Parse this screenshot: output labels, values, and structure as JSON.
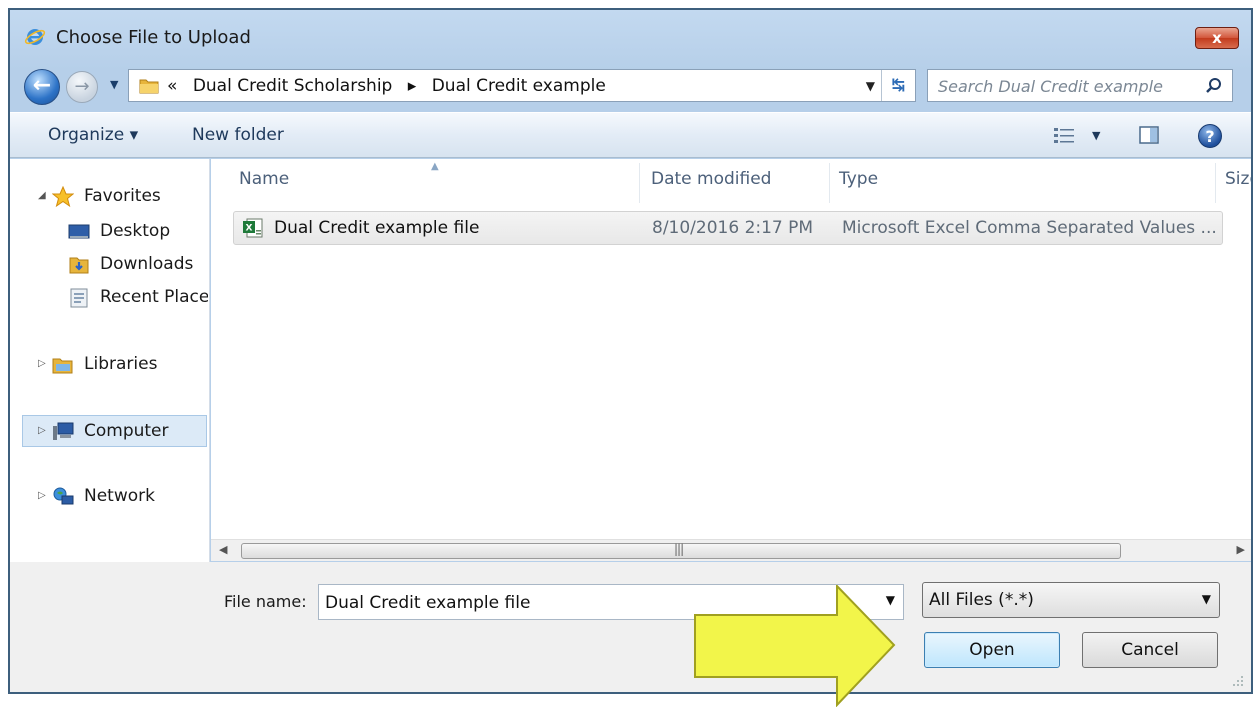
{
  "window": {
    "title": "Choose File to Upload",
    "close_label": "x"
  },
  "nav": {
    "breadcrumb_prefix": "«",
    "breadcrumbs": [
      "Dual Credit Scholarship",
      "Dual Credit example"
    ],
    "separator": "▸",
    "search_placeholder": "Search Dual Credit example"
  },
  "toolbar": {
    "organize_label": "Organize ▾",
    "new_folder_label": "New folder",
    "help_label": "?"
  },
  "sidebar": {
    "items": [
      {
        "label": "Favorites",
        "icon": "star-icon"
      },
      {
        "label": "Desktop",
        "icon": "desktop-icon"
      },
      {
        "label": "Downloads",
        "icon": "downloads-folder-icon"
      },
      {
        "label": "Recent Places",
        "icon": "recent-places-icon"
      },
      {
        "label": "Libraries",
        "icon": "libraries-icon"
      },
      {
        "label": "Computer",
        "icon": "computer-icon"
      },
      {
        "label": "Network",
        "icon": "network-icon"
      }
    ],
    "selected": "Computer"
  },
  "table": {
    "columns": [
      "Name",
      "Date modified",
      "Type",
      "Size"
    ],
    "rows": [
      {
        "name": "Dual Credit example file",
        "date": "8/10/2016 2:17 PM",
        "type": "Microsoft Excel Comma Separated Values ...",
        "icon": "excel-csv-icon"
      }
    ]
  },
  "footer": {
    "file_name_label": "File name:",
    "file_name_value": "Dual Credit example file",
    "file_type_value": "All Files (*.*)",
    "open_label": "Open",
    "cancel_label": "Cancel"
  },
  "colors": {
    "annotation_arrow": "#f2f54a",
    "close_button": "#c8432a",
    "selection": "#dceaf7"
  }
}
